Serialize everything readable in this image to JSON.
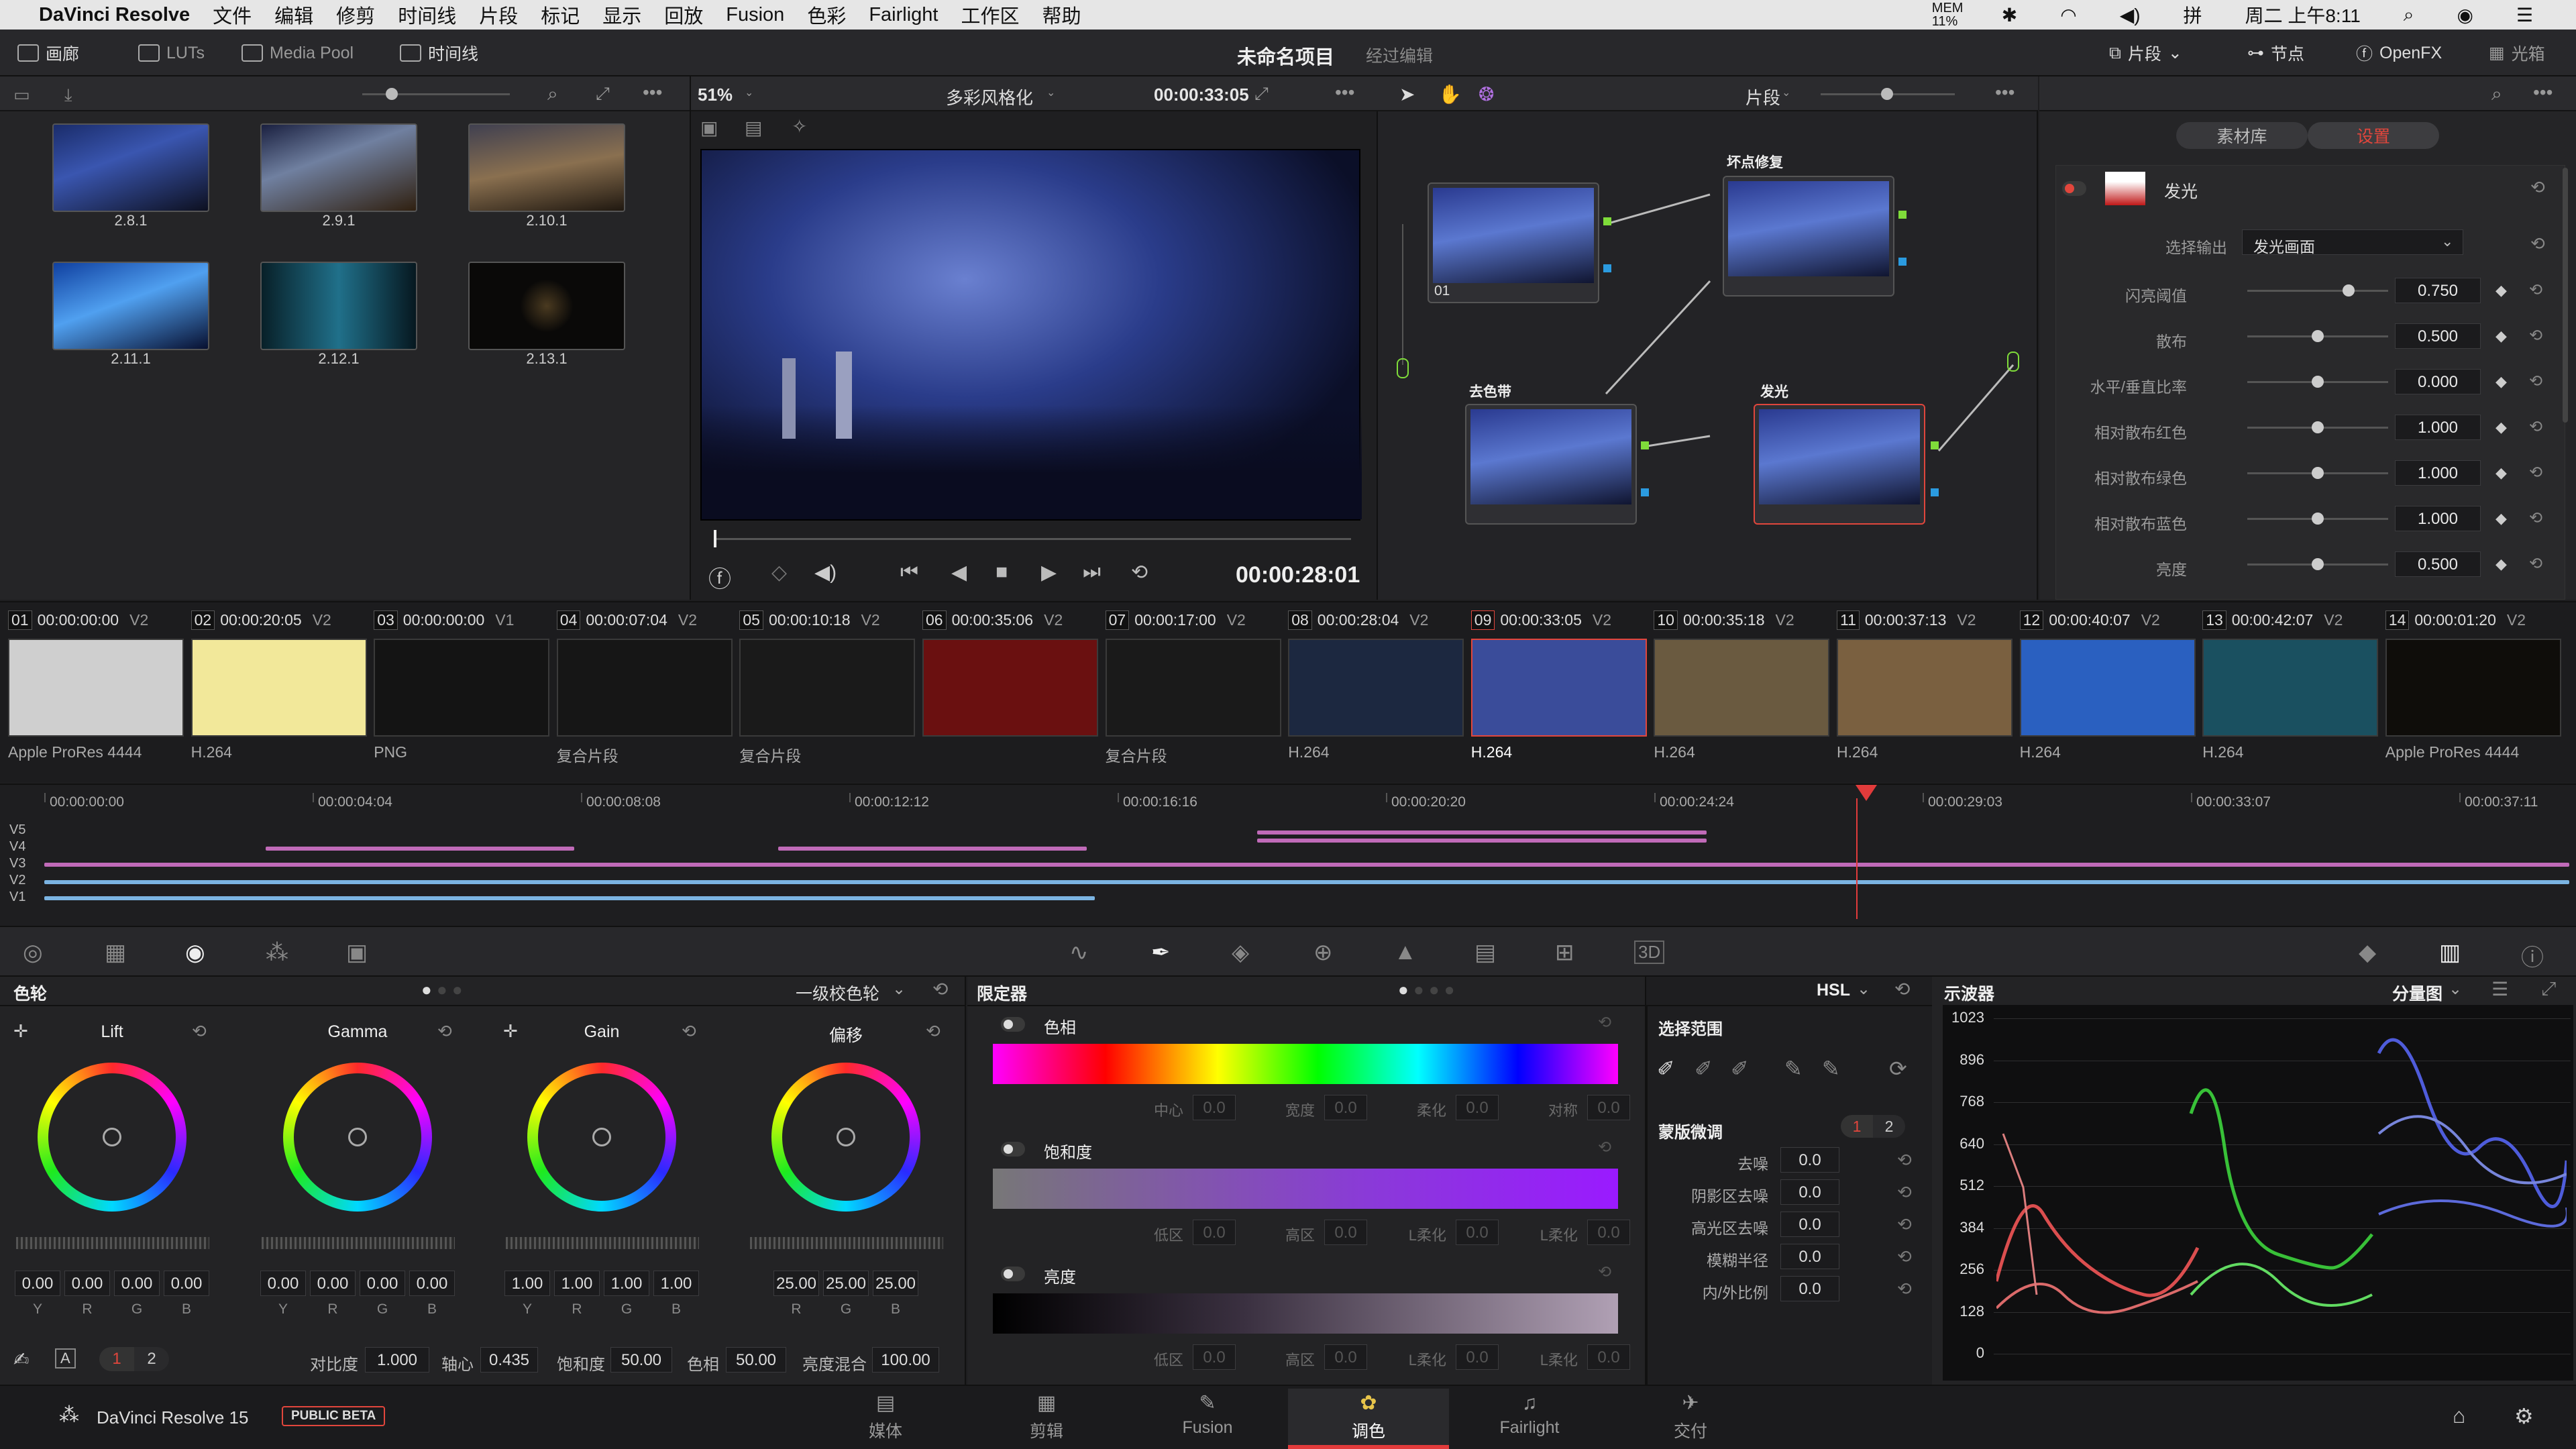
{
  "menubar": {
    "app": "DaVinci Resolve",
    "items": [
      "文件",
      "编辑",
      "修剪",
      "时间线",
      "片段",
      "标记",
      "显示",
      "回放",
      "Fusion",
      "色彩",
      "Fairlight",
      "工作区",
      "帮助"
    ],
    "status_mem": "MEM 11%",
    "clock": "周二 上午8:11"
  },
  "toolbar": {
    "gallery": "画廊",
    "luts": "LUTs",
    "media_pool": "Media Pool",
    "timeline": "时间线",
    "project_name": "未命名项目",
    "project_state": "经过编辑",
    "clip": "片段",
    "nodes": "节点",
    "openfx": "OpenFX",
    "lightbox": "光箱"
  },
  "gallery": {
    "stills": [
      "2.8.1",
      "2.9.1",
      "2.10.1",
      "2.11.1",
      "2.12.1",
      "2.13.1"
    ]
  },
  "viewer": {
    "zoom": "51%",
    "grade_name": "多彩风格化",
    "source_tc": "00:00:33:05",
    "playhead_tc": "00:00:28:01"
  },
  "node_editor": {
    "mode": "片段",
    "nodes": [
      {
        "label": "01",
        "title": ""
      },
      {
        "label": "",
        "title": "坏点修复"
      },
      {
        "label": "",
        "title": "去色带"
      },
      {
        "label": "",
        "title": "发光"
      }
    ]
  },
  "openfx": {
    "tab_library": "素材库",
    "tab_settings": "设置",
    "effect_name": "发光",
    "output_label": "选择输出",
    "output_value": "发光画面",
    "params": [
      {
        "name": "闪亮阈值",
        "value": "0.750",
        "level": 0.72
      },
      {
        "name": "散布",
        "value": "0.500",
        "level": 0.5
      },
      {
        "name": "水平/垂直比率",
        "value": "0.000",
        "level": 0.5
      },
      {
        "name": "相对散布红色",
        "value": "1.000",
        "level": 0.5
      },
      {
        "name": "相对散布绿色",
        "value": "1.000",
        "level": 0.5
      },
      {
        "name": "相对散布蓝色",
        "value": "1.000",
        "level": 0.5
      },
      {
        "name": "亮度",
        "value": "0.500",
        "level": 0.5
      }
    ]
  },
  "clips": [
    {
      "num": "01",
      "tc": "00:00:00:00",
      "track": "V2",
      "codec": "Apple ProRes 4444",
      "color": "#cfcfcf"
    },
    {
      "num": "02",
      "tc": "00:00:20:05",
      "track": "V2",
      "codec": "H.264",
      "color": "#f2e89a"
    },
    {
      "num": "03",
      "tc": "00:00:00:00",
      "track": "V1",
      "codec": "PNG",
      "color": "#141414"
    },
    {
      "num": "04",
      "tc": "00:00:07:04",
      "track": "V2",
      "codec": "复合片段",
      "color": "#161616"
    },
    {
      "num": "05",
      "tc": "00:00:10:18",
      "track": "V2",
      "codec": "复合片段",
      "color": "#1a1a1a"
    },
    {
      "num": "06",
      "tc": "00:00:35:06",
      "track": "V2",
      "codec": "",
      "color": "#6a1010"
    },
    {
      "num": "07",
      "tc": "00:00:17:00",
      "track": "V2",
      "codec": "复合片段",
      "color": "#1a1a1a"
    },
    {
      "num": "08",
      "tc": "00:00:28:04",
      "track": "V2",
      "codec": "H.264",
      "color": "#1c2840"
    },
    {
      "num": "09",
      "tc": "00:00:33:05",
      "track": "V2",
      "codec": "H.264",
      "color": "#3a4c9a"
    },
    {
      "num": "10",
      "tc": "00:00:35:18",
      "track": "V2",
      "codec": "H.264",
      "color": "#6a5a40"
    },
    {
      "num": "11",
      "tc": "00:00:37:13",
      "track": "V2",
      "codec": "H.264",
      "color": "#7a6040"
    },
    {
      "num": "12",
      "tc": "00:00:40:07",
      "track": "V2",
      "codec": "H.264",
      "color": "#2a60c0"
    },
    {
      "num": "13",
      "tc": "00:00:42:07",
      "track": "V2",
      "codec": "H.264",
      "color": "#1a5060"
    },
    {
      "num": "14",
      "tc": "00:00:01:20",
      "track": "V2",
      "codec": "Apple ProRes 4444",
      "color": "#0f0d0a"
    }
  ],
  "timeline": {
    "ruler": [
      "00:00:00:00",
      "00:00:04:04",
      "00:00:08:08",
      "00:00:12:12",
      "00:00:16:16",
      "00:00:20:20",
      "00:00:24:24",
      "00:00:29:03",
      "00:00:33:07",
      "00:00:37:11"
    ],
    "tracks": [
      "V5",
      "V4",
      "V3",
      "V2",
      "V1"
    ]
  },
  "color_wheels": {
    "title": "色轮",
    "mode": "一级校色轮",
    "wheels": [
      {
        "name": "Lift",
        "values": [
          "0.00",
          "0.00",
          "0.00",
          "0.00"
        ],
        "channels": [
          "Y",
          "R",
          "G",
          "B"
        ]
      },
      {
        "name": "Gamma",
        "values": [
          "0.00",
          "0.00",
          "0.00",
          "0.00"
        ],
        "channels": [
          "Y",
          "R",
          "G",
          "B"
        ]
      },
      {
        "name": "Gain",
        "values": [
          "1.00",
          "1.00",
          "1.00",
          "1.00"
        ],
        "channels": [
          "Y",
          "R",
          "G",
          "B"
        ]
      },
      {
        "name": "偏移",
        "values": [
          "25.00",
          "25.00",
          "25.00"
        ],
        "channels": [
          "R",
          "G",
          "B"
        ]
      }
    ],
    "page1": "1",
    "page2": "2",
    "contrast_label": "对比度",
    "contrast": "1.000",
    "pivot_label": "轴心",
    "pivot": "0.435",
    "sat_label": "饱和度",
    "sat": "50.00",
    "hue_label": "色相",
    "hue": "50.00",
    "lum_mix_label": "亮度混合",
    "lum_mix": "100.00"
  },
  "qualifier": {
    "title": "限定器",
    "mode": "HSL",
    "hue_label": "色相",
    "sat_label": "饱和度",
    "lum_label": "亮度",
    "hue_fields": [
      [
        "中心",
        "0.0"
      ],
      [
        "宽度",
        "0.0"
      ],
      [
        "柔化",
        "0.0"
      ],
      [
        "对称",
        "0.0"
      ]
    ],
    "sat_fields": [
      [
        "低区",
        "0.0"
      ],
      [
        "高区",
        "0.0"
      ],
      [
        "L柔化",
        "0.0"
      ],
      [
        "L柔化",
        "0.0"
      ]
    ],
    "lum_fields": [
      [
        "低区",
        "0.0"
      ],
      [
        "高区",
        "0.0"
      ],
      [
        "L柔化",
        "0.0"
      ],
      [
        "L柔化",
        "0.0"
      ]
    ],
    "selection_title": "选择范围",
    "matte_title": "蒙版微调",
    "matte_page1": "1",
    "matte_page2": "2",
    "matte_rows": [
      [
        "去噪",
        "0.0"
      ],
      [
        "阴影区去噪",
        "0.0"
      ],
      [
        "高光区去噪",
        "0.0"
      ],
      [
        "模糊半径",
        "0.0"
      ],
      [
        "内/外比例",
        "0.0"
      ]
    ]
  },
  "scope": {
    "title": "示波器",
    "mode": "分量图",
    "scale": [
      "1023",
      "896",
      "768",
      "640",
      "512",
      "384",
      "256",
      "128",
      "0"
    ]
  },
  "footer": {
    "app": "DaVinci Resolve 15",
    "badge": "PUBLIC BETA",
    "pages": [
      {
        "label": "媒体",
        "icon": "▤"
      },
      {
        "label": "剪辑",
        "icon": "▦"
      },
      {
        "label": "Fusion",
        "icon": "✎"
      },
      {
        "label": "调色",
        "icon": "✿"
      },
      {
        "label": "Fairlight",
        "icon": "♫"
      },
      {
        "label": "交付",
        "icon": "✈"
      }
    ],
    "active_page": "调色"
  }
}
